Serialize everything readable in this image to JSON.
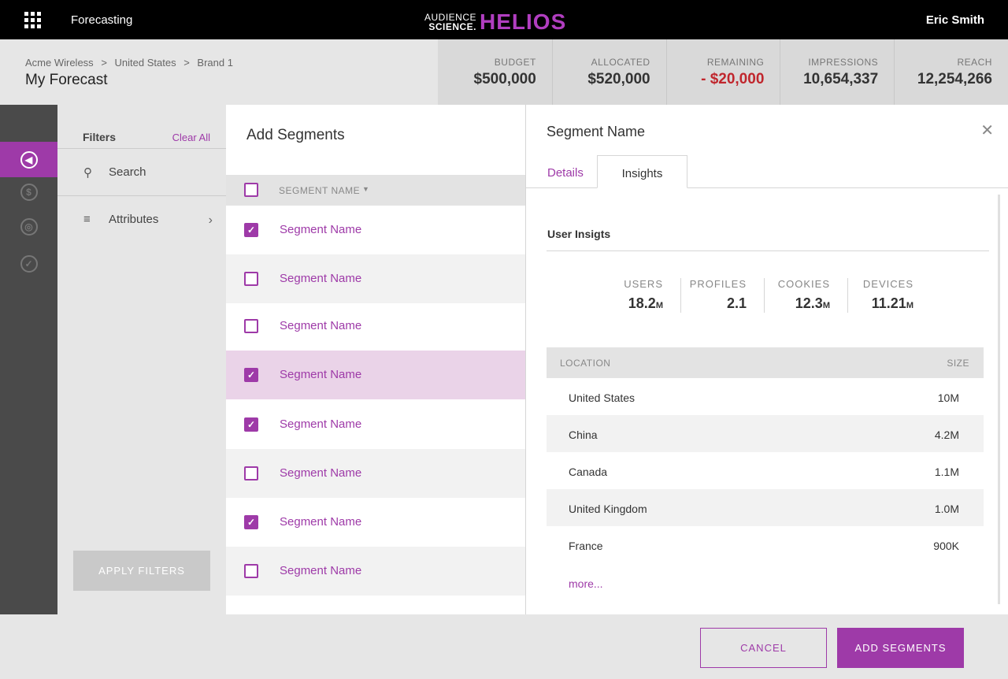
{
  "topbar": {
    "app_name": "Forecasting",
    "brand_small_top": "AUDIENCE",
    "brand_small_bottom": "SCIENCE.",
    "brand_big": "HELIOS",
    "user_name": "Eric Smith"
  },
  "header": {
    "breadcrumbs": [
      "Acme Wireless",
      "United States",
      "Brand 1"
    ],
    "breadcrumb_sep": ">",
    "title": "My Forecast"
  },
  "stats": [
    {
      "label": "BUDGET",
      "value": "$500,000"
    },
    {
      "label": "ALLOCATED",
      "value": "$520,000"
    },
    {
      "label": "REMAINING",
      "value": "- $20,000"
    },
    {
      "label": "IMPRESSIONS",
      "value": "10,654,337"
    },
    {
      "label": "REACH",
      "value": "12,254,266"
    }
  ],
  "rail": {
    "items": [
      {
        "icon": "megaphone-icon",
        "glyph": "◀"
      },
      {
        "icon": "dollar-icon",
        "glyph": "$"
      },
      {
        "icon": "target-icon",
        "glyph": "◎"
      },
      {
        "icon": "checklist-icon",
        "glyph": "✓"
      }
    ]
  },
  "filters": {
    "title": "Filters",
    "clear_all": "Clear All",
    "search_label": "Search",
    "attributes_label": "Attributes",
    "apply_label": "APPLY FILTERS"
  },
  "segments": {
    "title": "Add Segments",
    "column_header": "SEGMENT NAME",
    "rows": [
      {
        "name": "Segment Name",
        "checked": true
      },
      {
        "name": "Segment Name",
        "checked": false
      },
      {
        "name": "Segment Name",
        "checked": false
      },
      {
        "name": "Segment Name",
        "checked": true
      },
      {
        "name": "Segment Name",
        "checked": true
      },
      {
        "name": "Segment Name",
        "checked": false
      },
      {
        "name": "Segment Name",
        "checked": true
      },
      {
        "name": "Segment Name",
        "checked": false
      }
    ]
  },
  "detail": {
    "title": "Segment Name",
    "tabs": [
      "Details",
      "Insights"
    ],
    "active_tab": "Insights",
    "insights_title": "User Insigts",
    "metrics": [
      {
        "label": "USERS",
        "value": "18.2",
        "unit": "M"
      },
      {
        "label": "PROFILES",
        "value": "2.1",
        "unit": ""
      },
      {
        "label": "COOKIES",
        "value": "12.3",
        "unit": "M"
      },
      {
        "label": "DEVICES",
        "value": "11.21",
        "unit": "M"
      }
    ],
    "location_header": "LOCATION",
    "size_header": "SIZE",
    "locations": [
      {
        "name": "United States",
        "size": "10M"
      },
      {
        "name": "China",
        "size": "4.2M"
      },
      {
        "name": "Canada",
        "size": "1.1M"
      },
      {
        "name": "United Kingdom",
        "size": "1.0M"
      },
      {
        "name": "France",
        "size": "900K"
      }
    ],
    "more_label": "more..."
  },
  "footer": {
    "cancel_label": "CANCEL",
    "add_label": "ADD SEGMENTS"
  },
  "colors": {
    "accent": "#9e3aa8",
    "negative": "#c0262d",
    "highlight_row": "#ead3e8"
  }
}
